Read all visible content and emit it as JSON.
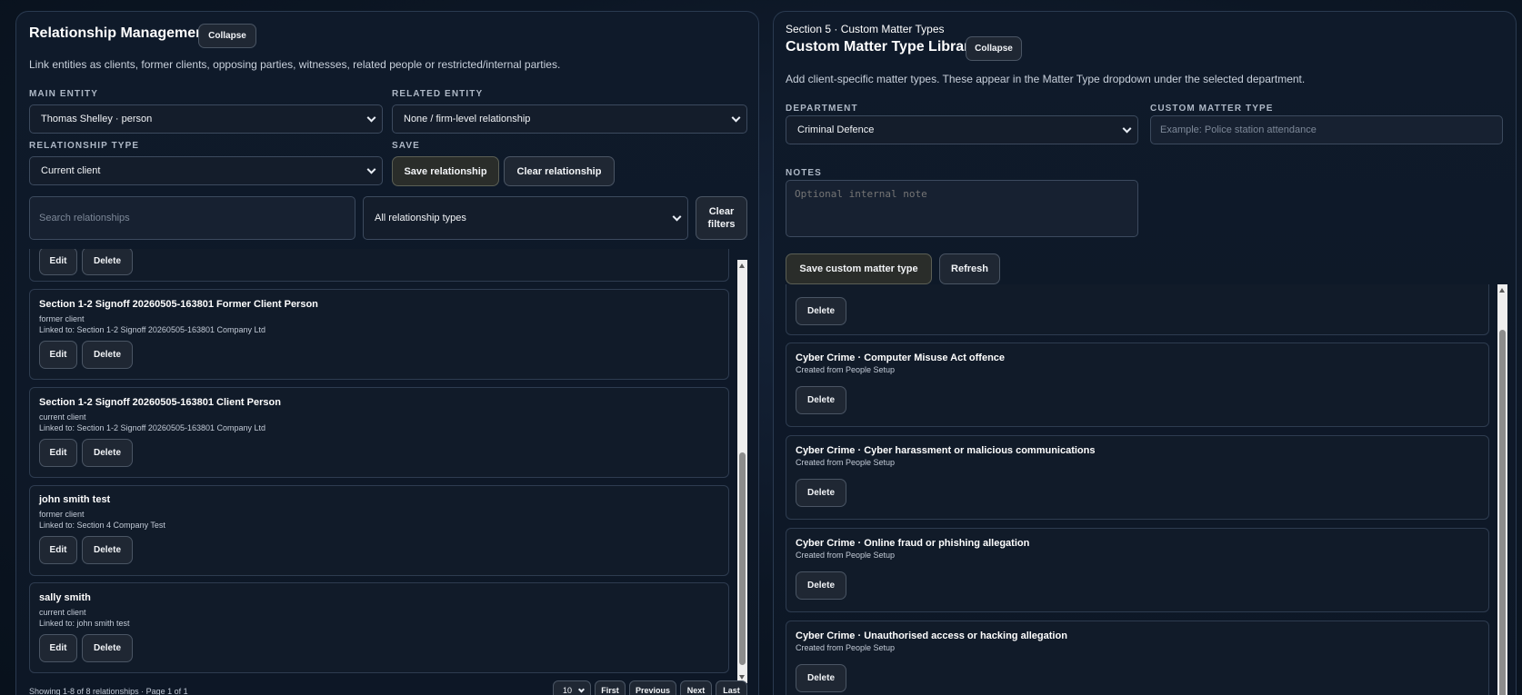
{
  "relationship": {
    "title": "Relationship Management",
    "collapse_label": "Collapse",
    "description": "Link entities as clients, former clients, opposing parties, witnesses, related people or restricted/internal parties.",
    "main_entity_label": "MAIN ENTITY",
    "main_entity_value": "Thomas Shelley · person",
    "related_entity_label": "RELATED ENTITY",
    "related_entity_value": "None / firm-level relationship",
    "type_label": "RELATIONSHIP TYPE",
    "type_value": "Current client",
    "save_label": "SAVE",
    "save_button": "Save relationship",
    "clear_button": "Clear relationship",
    "search_placeholder": "Search relationships",
    "filter_value": "All relationship types",
    "clear_filters_line1": "Clear",
    "clear_filters_line2": "filters",
    "edit_label": "Edit",
    "delete_label": "Delete",
    "items": [
      {
        "name": "Section 1-2 Signoff 20260505-163801 Former Client Person",
        "type": "former client",
        "linked": "Linked to: Section 1-2 Signoff 20260505-163801 Company Ltd"
      },
      {
        "name": "Section 1-2 Signoff 20260505-163801 Client Person",
        "type": "current client",
        "linked": "Linked to: Section 1-2 Signoff 20260505-163801 Company Ltd"
      },
      {
        "name": "john smith test",
        "type": "former client",
        "linked": "Linked to: Section 4 Company Test"
      },
      {
        "name": "sally smith",
        "type": "current client",
        "linked": "Linked to: john smith test"
      }
    ],
    "pager": {
      "summary": "Showing 1-8 of 8 relationships · Page 1 of 1",
      "page_size": "10",
      "first": "First",
      "previous": "Previous",
      "next": "Next",
      "last": "Last"
    }
  },
  "matter_types": {
    "section": "Section 5 · Custom Matter Types",
    "title": "Custom Matter Type Library",
    "collapse_label": "Collapse",
    "description": "Add client-specific matter types. These appear in the Matter Type dropdown under the selected department.",
    "department_label": "DEPARTMENT",
    "department_value": "Criminal Defence",
    "custom_type_label": "CUSTOM MATTER TYPE",
    "custom_type_placeholder": "Example: Police station attendance",
    "notes_label": "NOTES",
    "notes_placeholder": "Optional internal note",
    "save_button": "Save custom matter type",
    "refresh_button": "Refresh",
    "delete_label": "Delete",
    "items": [
      {
        "name": "Cyber Crime · Computer Misuse Act offence",
        "source": "Created from People Setup"
      },
      {
        "name": "Cyber Crime · Cyber harassment or malicious communications",
        "source": "Created from People Setup"
      },
      {
        "name": "Cyber Crime · Online fraud or phishing allegation",
        "source": "Created from People Setup"
      },
      {
        "name": "Cyber Crime · Unauthorised access or hacking allegation",
        "source": "Created from People Setup"
      }
    ]
  }
}
